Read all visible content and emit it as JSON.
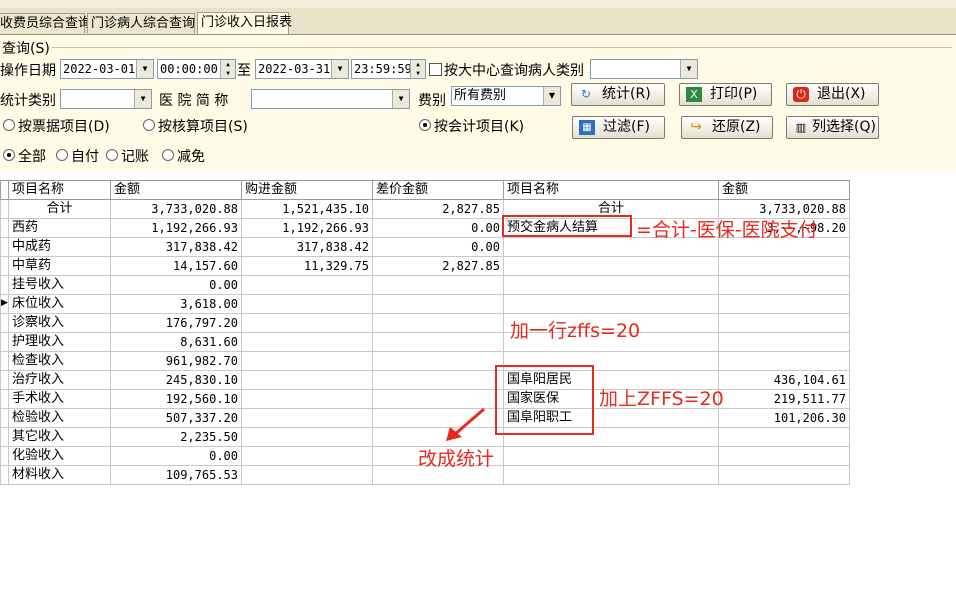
{
  "tabs": [
    "收费员综合查询",
    "门诊病人综合查询",
    "门诊收入日报表"
  ],
  "query": {
    "legend": "查询(S)",
    "date_label": "操作日期",
    "start_date": "2022-03-01",
    "start_time": "00:00:00",
    "to": "至",
    "end_date": "2022-03-31",
    "end_time": "23:59:59",
    "center_check_label": "按大中心查询病人类别",
    "stat_type_label": "统计类别",
    "hospital_abbr_label": "医 院 简 称",
    "fee_type_label": "费别",
    "fee_type_value": "所有费别"
  },
  "buttons": {
    "stats": "统计(R)",
    "print": "打印(P)",
    "exit": "退出(X)",
    "filter": "过滤(F)",
    "restore": "还原(Z)",
    "column_select": "列选择(Q)"
  },
  "radios": {
    "by_receipt": "按票据项目(D)",
    "by_accounting_item": "按核算项目(S)",
    "by_account": "按会计项目(K)",
    "all": "全部",
    "self_pay": "自付",
    "credit": "记账",
    "discount": "减免"
  },
  "table": {
    "headers": [
      "项目名称",
      "金额",
      "购进金额",
      "差价金额",
      "项目名称",
      "金额"
    ],
    "rows": [
      [
        "合计",
        "3,733,020.88",
        "1,521,435.10",
        "2,827.85",
        "合计",
        "3,733,020.88"
      ],
      [
        "西药",
        "1,192,266.93",
        "1,192,266.93",
        "0.00",
        "预交金病人结算",
        "3,~~,~98.20"
      ],
      [
        "中成药",
        "317,838.42",
        "317,838.42",
        "0.00",
        "",
        ""
      ],
      [
        "中草药",
        "14,157.60",
        "11,329.75",
        "2,827.85",
        "",
        ""
      ],
      [
        "挂号收入",
        "0.00",
        "",
        "",
        "",
        ""
      ],
      [
        "床位收入",
        "3,618.00",
        "",
        "",
        "",
        ""
      ],
      [
        "诊察收入",
        "176,797.20",
        "",
        "",
        "",
        ""
      ],
      [
        "护理收入",
        "8,631.60",
        "",
        "",
        "",
        ""
      ],
      [
        "检查收入",
        "961,982.70",
        "",
        "",
        "",
        ""
      ],
      [
        "治疗收入",
        "245,830.10",
        "",
        "",
        "国阜阳居民",
        "436,104.61"
      ],
      [
        "手术收入",
        "192,560.10",
        "",
        "",
        "国家医保",
        "219,511.77"
      ],
      [
        "检验收入",
        "507,337.20",
        "",
        "",
        "国阜阳职工",
        "101,206.30"
      ],
      [
        "其它收入",
        "2,235.50",
        "",
        "",
        "",
        ""
      ],
      [
        "化验收入",
        "0.00",
        "",
        "",
        "",
        ""
      ],
      [
        "材料收入",
        "109,765.53",
        "",
        "",
        "",
        ""
      ]
    ]
  },
  "annotations": {
    "formula": "=合计-医保-医院支付",
    "add_row": "加一行zffs=20",
    "add_zffs": "加上ZFFS=20",
    "change_to_stats": "改成统计"
  },
  "colors": {
    "annotation": "#e8291d",
    "panel_bg": "#fffbe6"
  }
}
